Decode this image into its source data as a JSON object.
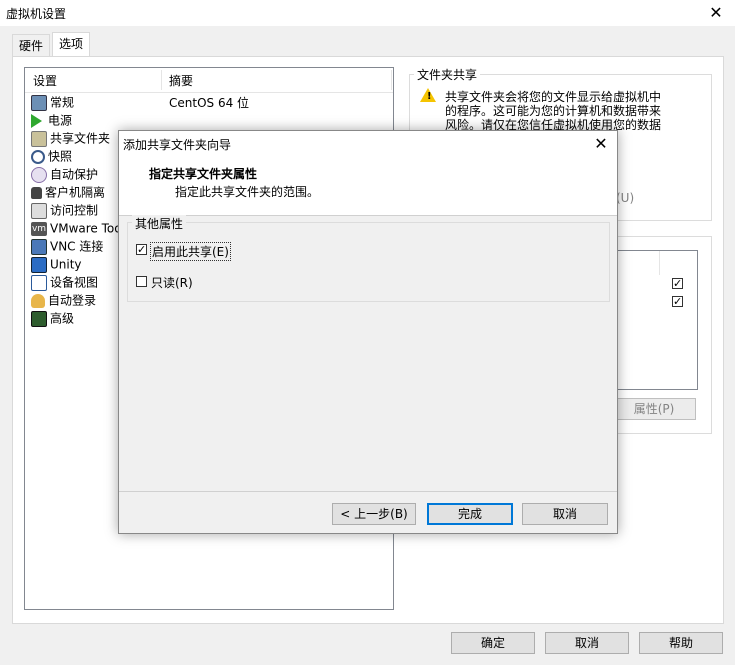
{
  "window": {
    "title": "虚拟机设置"
  },
  "tabs": [
    {
      "label": "硬件"
    },
    {
      "label": "选项"
    }
  ],
  "settings_list": {
    "headers": {
      "setting": "设置",
      "summary": "摘要"
    },
    "items": [
      {
        "label": "常规",
        "summary": "CentOS 64 位",
        "icon": "monitor-icon"
      },
      {
        "label": "电源",
        "summary": "",
        "icon": "power-play-icon"
      },
      {
        "label": "共享文件夹",
        "summary": "",
        "icon": "shared-folder-icon"
      },
      {
        "label": "快照",
        "summary": "",
        "icon": "snapshot-icon"
      },
      {
        "label": "自动保护",
        "summary": "",
        "icon": "autoprotect-icon"
      },
      {
        "label": "客户机隔离",
        "summary": "",
        "icon": "lock-icon"
      },
      {
        "label": "访问控制",
        "summary": "",
        "icon": "access-control-icon"
      },
      {
        "label": "VMware Too",
        "summary": "",
        "icon": "vm-icon"
      },
      {
        "label": "VNC 连接",
        "summary": "",
        "icon": "vnc-icon"
      },
      {
        "label": "Unity",
        "summary": "",
        "icon": "unity-icon"
      },
      {
        "label": "设备视图",
        "summary": "",
        "icon": "device-view-icon"
      },
      {
        "label": "自动登录",
        "summary": "",
        "icon": "user-login-icon"
      },
      {
        "label": "高级",
        "summary": "",
        "icon": "advanced-icon"
      }
    ]
  },
  "folder_sharing": {
    "title": "文件夹共享",
    "warning_lines": [
      "共享文件夹会将您的文件显示给虚拟机中",
      "的程序。这可能为您的计算机和数据带来",
      "风险。请仅在您信任虚拟机使用您的数据"
    ],
    "partial_button_label": "(U)",
    "properties_button": "属性(P)"
  },
  "dialog": {
    "title": "添加共享文件夹向导",
    "heading": "指定共享文件夹属性",
    "subheading": "指定此共享文件夹的范围。",
    "group_title": "其他属性",
    "enable_share": {
      "label": "启用此共享(E)",
      "checked": true
    },
    "read_only": {
      "label": "只读(R)",
      "checked": false
    },
    "buttons": {
      "back": "< 上一步(B)",
      "finish": "完成",
      "cancel": "取消"
    }
  },
  "footer_buttons": {
    "ok": "确定",
    "cancel": "取消",
    "help": "帮助"
  },
  "colors": {
    "accent": "#0078d7",
    "warning": "#f5c400",
    "selection": "#cce8ff"
  }
}
